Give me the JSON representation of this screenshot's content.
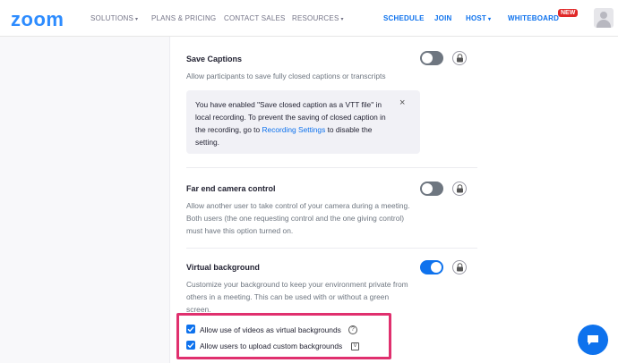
{
  "nav": {
    "logo": "zoom",
    "solutions": "SOLUTIONS",
    "plans": "PLANS & PRICING",
    "contact": "CONTACT SALES",
    "resources": "RESOURCES",
    "schedule": "SCHEDULE",
    "join": "JOIN",
    "host": "HOST",
    "whiteboard": "WHITEBOARD",
    "new_badge": "NEW",
    "caret": "▾"
  },
  "settings": {
    "save_captions": {
      "title": "Save Captions",
      "description": "Allow participants to save fully closed captions or transcripts",
      "enabled": false
    },
    "info_box": {
      "text_before": "You have enabled \"Save closed caption as a VTT file\" in local recording. To prevent the saving of closed caption in the recording, go to ",
      "link": "Recording Settings",
      "text_after": " to disable the setting.",
      "close": "×"
    },
    "far_end_camera": {
      "title": "Far end camera control",
      "description": "Allow another user to take control of your camera during a meeting. Both users (the one requesting control and the one giving control) must have this option turned on.",
      "enabled": false
    },
    "virtual_background": {
      "title": "Virtual background",
      "description": "Customize your background to keep your environment private from others in a meeting. This can be used with or without a green screen.",
      "enabled": true,
      "options": [
        {
          "label": "Allow use of videos as virtual backgrounds",
          "checked": true
        },
        {
          "label": "Allow users to upload custom backgrounds",
          "checked": true
        }
      ],
      "help_glyph": "?",
      "v_glyph": "V"
    }
  },
  "colors": {
    "brand": "#2d8cff",
    "accent": "#0e72ed",
    "highlight": "#e0306e"
  }
}
